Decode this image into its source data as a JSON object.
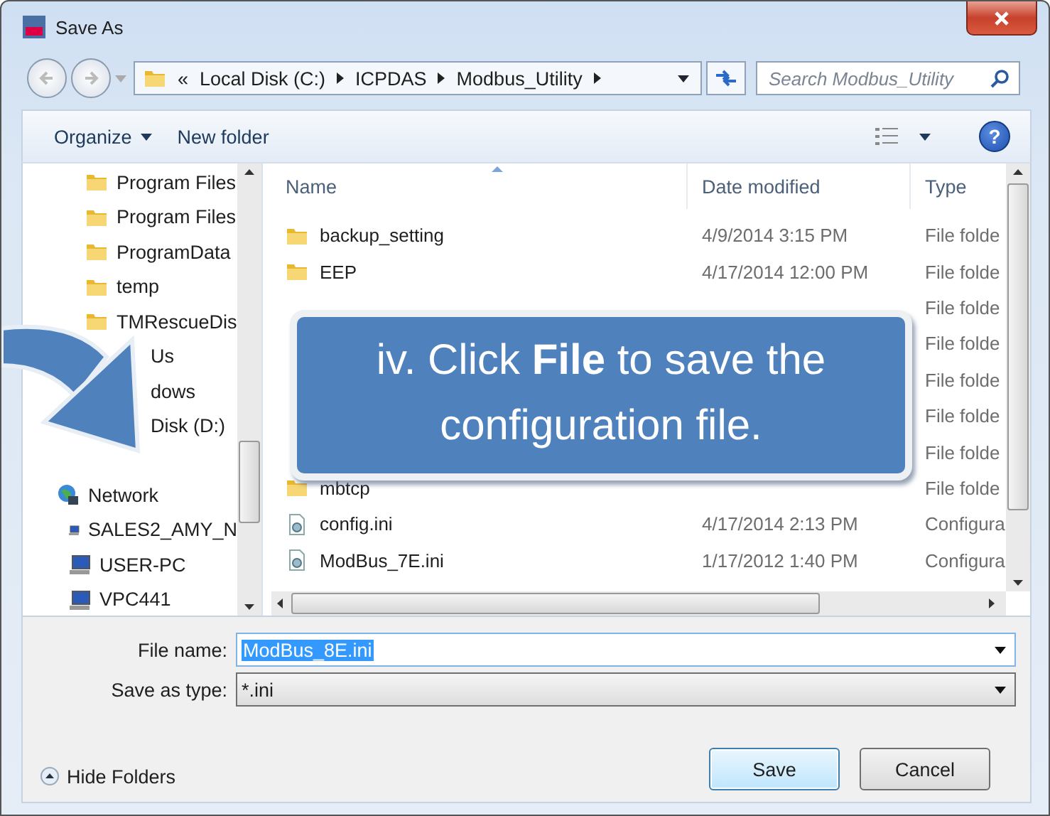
{
  "window": {
    "title": "Save As"
  },
  "address_bar": {
    "prefix": "«",
    "segments": [
      "Local Disk (C:)",
      "ICPDAS",
      "Modbus_Utility"
    ]
  },
  "search": {
    "placeholder": "Search Modbus_Utility"
  },
  "toolbar": {
    "help": "?",
    "buttons": [
      {
        "label": "Organize",
        "kind": "menu"
      },
      {
        "label": "New folder",
        "kind": "plain"
      }
    ]
  },
  "sidebar": {
    "items": [
      {
        "label": "Program Files",
        "kind": "folder"
      },
      {
        "label": "Program Files",
        "kind": "folder"
      },
      {
        "label": "ProgramData",
        "kind": "folder"
      },
      {
        "label": "temp",
        "kind": "folder"
      },
      {
        "label": "TMRescueDis",
        "kind": "folder"
      },
      {
        "label": "Us",
        "kind": "covered"
      },
      {
        "label": "dows",
        "kind": "covered"
      },
      {
        "label": "Disk (D:)",
        "kind": "covered"
      },
      {
        "label": "Network",
        "kind": "network",
        "children": [
          {
            "label": "SALES2_AMY_N",
            "kind": "computer"
          },
          {
            "label": "USER-PC",
            "kind": "computer"
          },
          {
            "label": "VPC441",
            "kind": "computer"
          }
        ]
      }
    ]
  },
  "file_list": {
    "columns": [
      "Name",
      "Date modified",
      "Type"
    ],
    "rows": [
      {
        "kind": "folder",
        "name": "backup_setting",
        "date": "4/9/2014 3:15 PM",
        "type": "File folde"
      },
      {
        "kind": "folder",
        "name": "EEP",
        "date": "4/17/2014 12:00 PM",
        "type": "File folde"
      },
      {
        "kind": "covered",
        "type": "File folde"
      },
      {
        "kind": "covered",
        "type": "File folde"
      },
      {
        "kind": "covered",
        "type": "File folde"
      },
      {
        "kind": "covered",
        "type": "File folde"
      },
      {
        "kind": "covered",
        "type": "File folde"
      },
      {
        "kind": "folder",
        "name": "mbtcp",
        "type": "File folde"
      },
      {
        "kind": "ini",
        "name": "config.ini",
        "date": "4/17/2014 2:13 PM",
        "type": "Configura"
      },
      {
        "kind": "ini",
        "name": "ModBus_7E.ini",
        "date": "1/17/2012 1:40 PM",
        "type": "Configura"
      }
    ]
  },
  "file_name": {
    "label": "File name:",
    "value": "ModBus_8E.ini"
  },
  "save_as_type": {
    "label": "Save as type:",
    "value": "*.ini"
  },
  "hide_folders": "Hide Folders",
  "buttons": [
    {
      "label": "Save",
      "default": true
    },
    {
      "label": "Cancel",
      "default": false
    }
  ],
  "callout": {
    "text": "iv. Click **File** to save the configuration file."
  }
}
